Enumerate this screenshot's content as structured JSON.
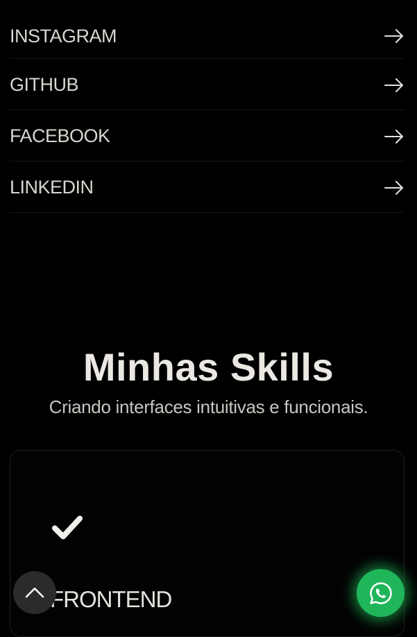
{
  "social_links": [
    {
      "label": "INSTAGRAM",
      "icon": "arrow-right-icon"
    },
    {
      "label": "GITHUB",
      "icon": "arrow-right-icon"
    },
    {
      "label": "FACEBOOK",
      "icon": "arrow-right-icon"
    },
    {
      "label": "LINKEDIN",
      "icon": "arrow-right-icon"
    }
  ],
  "skills": {
    "title": "Minhas Skills",
    "subtitle": "Criando interfaces intuitivas e funcionais.",
    "card": {
      "icon": "checkmark-icon",
      "title": "FRONTEND"
    }
  },
  "floating": {
    "scroll_top_icon": "chevron-up-icon",
    "whatsapp_icon": "whatsapp-icon"
  },
  "colors": {
    "background": "#000000",
    "text": "#e8e6e1",
    "whatsapp_green": "#1fb65a",
    "scroll_button": "#2b2b2b"
  }
}
